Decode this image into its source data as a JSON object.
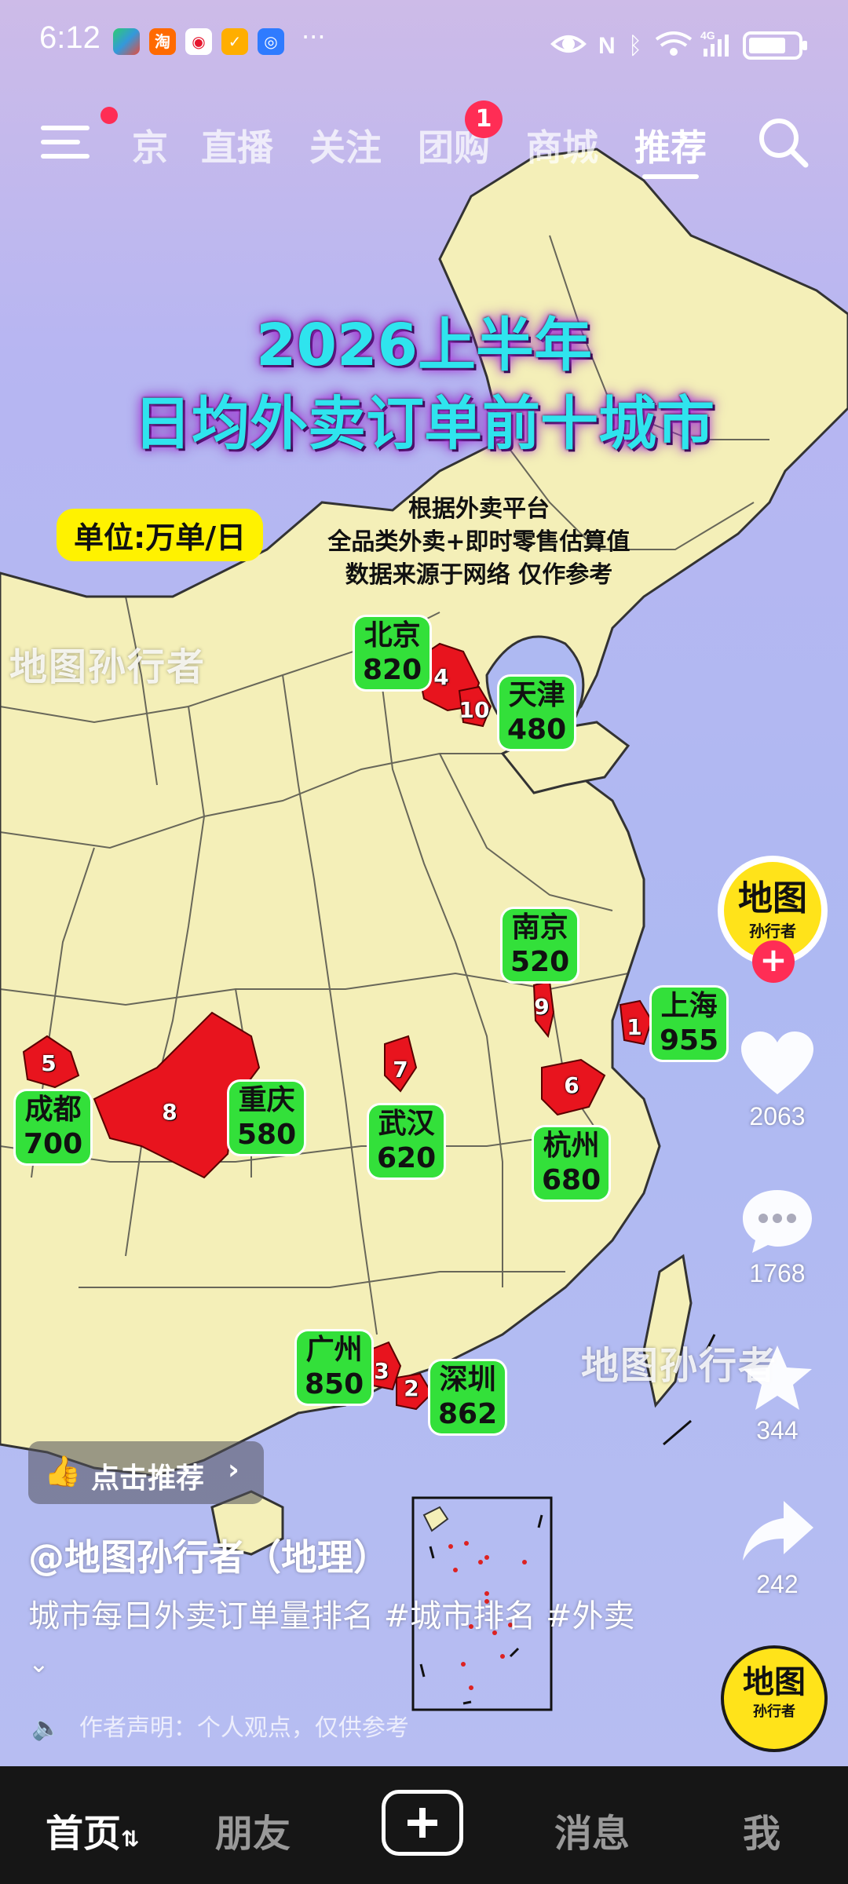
{
  "status_bar": {
    "time": "6:12",
    "more": "···",
    "network": "4G"
  },
  "top_nav": {
    "tabs": [
      {
        "label": "京"
      },
      {
        "label": "直播"
      },
      {
        "label": "关注"
      },
      {
        "label": "团购"
      },
      {
        "label": "商城"
      },
      {
        "label": "推荐"
      }
    ],
    "badge_count": "1",
    "active_tab": "推荐"
  },
  "video": {
    "title_line1": "2026上半年",
    "title_line2": "日均外卖订单前十城市",
    "unit": "单位:万单/日",
    "note_lines": [
      "根据外卖平台",
      "全品类外卖+即时零售估算值",
      "数据来源于网络 仅作参考"
    ],
    "watermark": "地图孙行者",
    "cities": [
      {
        "rank": "1",
        "name": "上海",
        "value": "955"
      },
      {
        "rank": "2",
        "name": "深圳",
        "value": "862"
      },
      {
        "rank": "3",
        "name": "广州",
        "value": "850"
      },
      {
        "rank": "4",
        "name": "北京",
        "value": "820"
      },
      {
        "rank": "5",
        "name": "成都",
        "value": "700"
      },
      {
        "rank": "6",
        "name": "杭州",
        "value": "680"
      },
      {
        "rank": "7",
        "name": "武汉",
        "value": "620"
      },
      {
        "rank": "8",
        "name": "重庆",
        "value": "580"
      },
      {
        "rank": "9",
        "name": "南京",
        "value": "520"
      },
      {
        "rank": "10",
        "name": "天津",
        "value": "480"
      }
    ]
  },
  "actions": {
    "avatar_text_big": "地图",
    "avatar_text_small": "孙行者",
    "likes": "2063",
    "comments": "1768",
    "favorites": "344",
    "shares": "242"
  },
  "post": {
    "recommend_label": "点击推荐",
    "author": "@地图孙行者（地理）",
    "description": "城市每日外卖订单量排名 #城市排名 #外卖",
    "disclaimer": "作者声明：个人观点，仅供参考"
  },
  "bottom_nav": {
    "home": "首页",
    "friends": "朋友",
    "messages": "消息",
    "me": "我"
  },
  "colors": {
    "title_cyan": "#2fe4ee",
    "city_green": "#33e03a",
    "highlight_red": "#e8141e",
    "unit_yellow": "#fff200",
    "accent_pink": "#ff2d55"
  }
}
